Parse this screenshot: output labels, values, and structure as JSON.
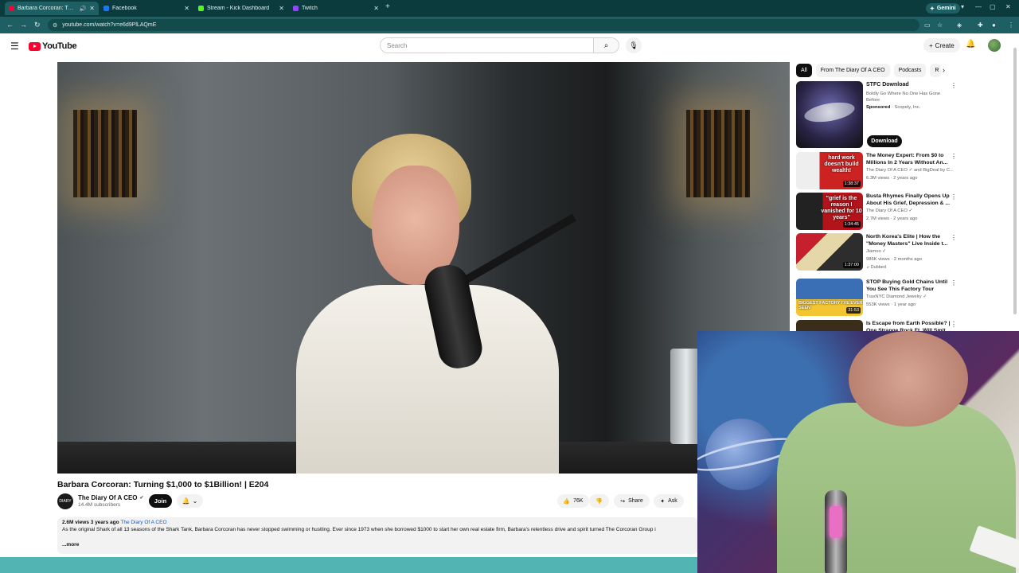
{
  "browser": {
    "tabs": [
      {
        "title": "Barbara Corcoran: Turning",
        "color": "#ff0033",
        "active": true
      },
      {
        "title": "Facebook",
        "color": "#1877f2",
        "active": false
      },
      {
        "title": "Stream - Kick Dashboard",
        "color": "#53fc18",
        "active": false
      },
      {
        "title": "Twitch",
        "color": "#9146ff",
        "active": false
      }
    ],
    "gemini_label": "Gemini",
    "url": "youtube.com/watch?v=e6d9PlLAQmE"
  },
  "youtube": {
    "logo_text": "YouTube",
    "search_placeholder": "Search",
    "create_label": "Create"
  },
  "video": {
    "title": "Barbara Corcoran: Turning $1,000 to $1Billion! | E204",
    "channel_name": "The Diary Of A CEO",
    "channel_avatar_text": "DIARY",
    "subscribers": "14.4M subscribers",
    "join_label": "Join",
    "like_count": "76K",
    "share_label": "Share",
    "ask_label": "Ask",
    "views_date": "2.6M views  3 years ago",
    "desc_tag": "The Diary Of A CEO",
    "description": "As the original Shark of all 13 seasons of the Shark Tank, Barbara Corcoran has never stopped swimming or hustling. Ever since 1973 when she borrowed $1000 to start her own real estate firm, Barbara's relentless drive and spirit turned The Corcoran Group i",
    "more_label": "...more"
  },
  "sidebar": {
    "chips": [
      "All",
      "From The Diary Of A CEO",
      "Podcasts",
      "R"
    ],
    "ad": {
      "title": "STFC Download",
      "desc": "Boldly Go Where No One Has Gone Before",
      "sponsored": "Sponsored",
      "advertiser": "· Scopely, Inc.",
      "button": "Download"
    },
    "recs": [
      {
        "title": "The Money Expert: From $0 to Millions In 2 Years Without An...",
        "channel": "The Diary Of A CEO ✓ and BigDeal by C...",
        "stats": "6.3M views · 2 years ago",
        "duration": "1:38:37",
        "thumb_text": "hard work doesn't build wealth!",
        "badge": ""
      },
      {
        "title": "Busta Rhymes Finally Opens Up About His Grief, Depression & ...",
        "channel": "The Diary Of A CEO ✓",
        "stats": "2.7M views · 2 years ago",
        "duration": "1:34:45",
        "thumb_text": "\"grief is the reason I vanished for 10 years\"",
        "badge": ""
      },
      {
        "title": "North Korea's Elite | How the \"Money Masters\" Live Inside t...",
        "channel": "Jiamoo ✓",
        "stats": "986K views · 2 months ago",
        "duration": "1:37:00",
        "thumb_text": "",
        "badge": "Dubbed"
      },
      {
        "title": "STOP Buying Gold Chains Until You See This Factory Tour",
        "channel": "TraxNYC Diamond Jewelry ✓",
        "stats": "553K views · 1 year ago",
        "duration": "31:53",
        "thumb_text": "BIGGEST FACTORY I'VE EVER SEEN",
        "badge": ""
      },
      {
        "title": "Is Escape from Earth Possible? | One Strange Rock Ft. Will Smit...",
        "channel": "",
        "stats": "",
        "duration": "",
        "thumb_text": "",
        "badge": ""
      }
    ]
  },
  "icons": {
    "menu": "hamburger-icon",
    "search": "search-icon",
    "mic": "microphone-icon",
    "bell": "bell-icon"
  }
}
